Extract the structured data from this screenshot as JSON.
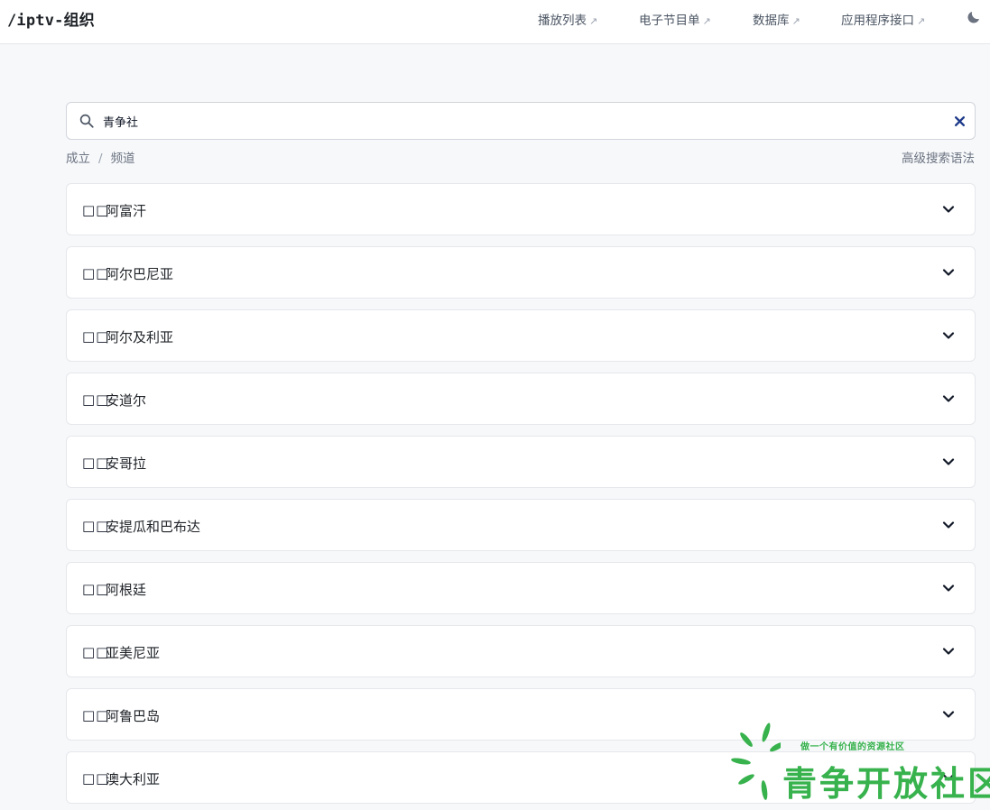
{
  "header": {
    "logo": "/iptv-组织",
    "nav": [
      {
        "label": "播放列表",
        "arrow": "↗"
      },
      {
        "label": "电子节目单",
        "arrow": "↗"
      },
      {
        "label": "数据库",
        "arrow": "↗"
      },
      {
        "label": "应用程序接口",
        "arrow": "↗"
      }
    ],
    "theme_icon": "moon-icon"
  },
  "search": {
    "value": "青争社",
    "icon": "search-icon",
    "clear_icon": "close-icon"
  },
  "breadcrumb": {
    "items": [
      "成立",
      "频道"
    ],
    "separator": "/"
  },
  "advanced_search_label": "高级搜索语法",
  "countries": [
    {
      "flag": "□□",
      "name": "阿富汗"
    },
    {
      "flag": "□□",
      "name": "阿尔巴尼亚"
    },
    {
      "flag": "□□",
      "name": "阿尔及利亚"
    },
    {
      "flag": "□□",
      "name": "安道尔"
    },
    {
      "flag": "□□",
      "name": "安哥拉"
    },
    {
      "flag": "□□",
      "name": "安提瓜和巴布达"
    },
    {
      "flag": "□□",
      "name": "阿根廷"
    },
    {
      "flag": "□□",
      "name": "亚美尼亚"
    },
    {
      "flag": "□□",
      "name": "阿鲁巴岛"
    },
    {
      "flag": "□□",
      "name": "澳大利亚"
    }
  ],
  "watermark": {
    "slogan": "做一个有价值的资源社区",
    "name": "青争开放社区",
    "color": "#37b24d"
  }
}
